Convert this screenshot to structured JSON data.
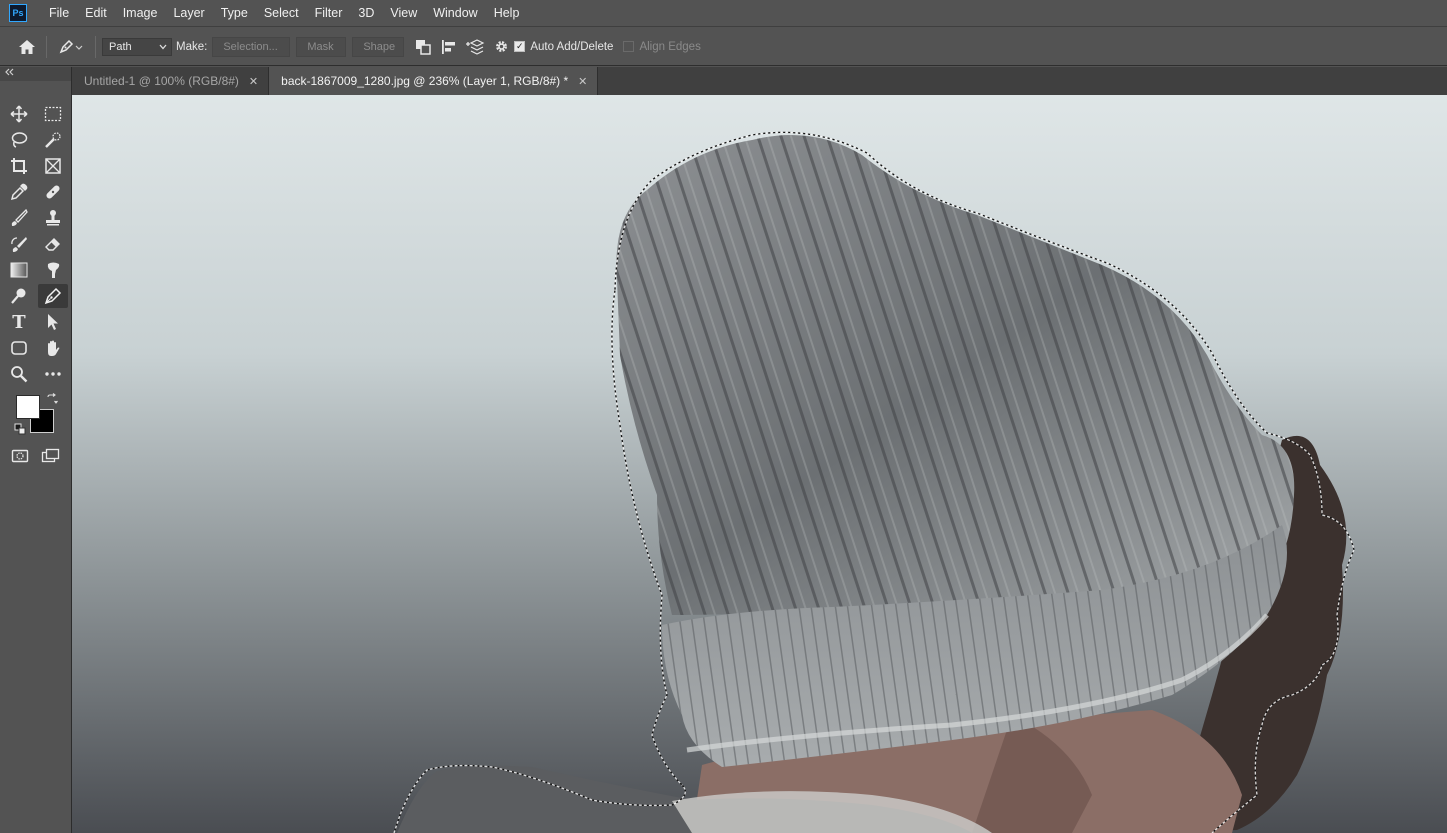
{
  "app": {
    "logo_text": "Ps"
  },
  "menu": [
    "File",
    "Edit",
    "Image",
    "Layer",
    "Type",
    "Select",
    "Filter",
    "3D",
    "View",
    "Window",
    "Help"
  ],
  "options_bar": {
    "mode_value": "Path",
    "make_label": "Make:",
    "selection_label": "Selection...",
    "mask_label": "Mask",
    "shape_label": "Shape",
    "auto_add_delete_label": "Auto Add/Delete",
    "auto_add_delete_checked": true,
    "align_edges_label": "Align Edges",
    "align_edges_checked": false
  },
  "tabs": [
    {
      "label": "Untitled-1 @ 100% (RGB/8#)",
      "active": false
    },
    {
      "label": "back-1867009_1280.jpg @ 236% (Layer 1, RGB/8#) *",
      "active": true
    }
  ],
  "tools": [
    "move-tool",
    "marquee-tool",
    "lasso-tool",
    "quick-selection-tool",
    "crop-tool",
    "frame-tool",
    "eyedropper-tool",
    "healing-brush-tool",
    "brush-tool",
    "clone-stamp-tool",
    "history-brush-tool",
    "eraser-tool",
    "gradient-tool",
    "smudge-tool",
    "dodge-tool",
    "pen-tool",
    "type-tool",
    "path-selection-tool",
    "rectangle-tool",
    "hand-tool",
    "zoom-tool",
    "more-tools"
  ],
  "active_tool": "pen-tool",
  "colors": {
    "foreground": "#ffffff",
    "background": "#000000"
  },
  "tool_glyphs": {
    "type": "T"
  }
}
